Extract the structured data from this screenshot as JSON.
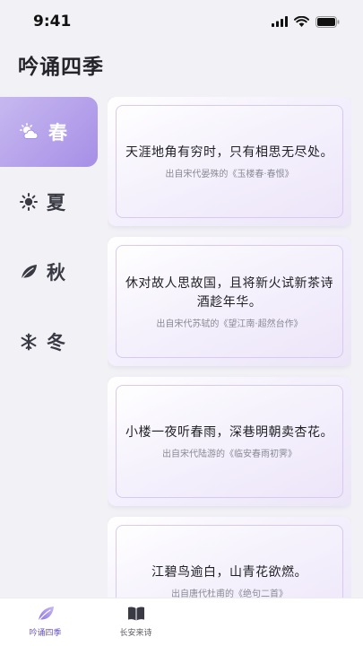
{
  "status_bar": {
    "time": "9:41"
  },
  "app": {
    "title": "吟诵四季"
  },
  "seasons": [
    {
      "label": "春",
      "icon": "cloud-sun-icon",
      "active": true
    },
    {
      "label": "夏",
      "icon": "sun-icon",
      "active": false
    },
    {
      "label": "秋",
      "icon": "leaf-icon",
      "active": false
    },
    {
      "label": "冬",
      "icon": "snowflake-icon",
      "active": false
    }
  ],
  "poems": [
    {
      "text": "天涯地角有穷时，只有相思无尽处。",
      "source": "出自宋代晏殊的《玉楼春·春恨》"
    },
    {
      "text": "休对故人思故国，且将新火试新茶诗酒趁年华。",
      "source": "出自宋代苏轼的《望江南·超然台作》"
    },
    {
      "text": "小楼一夜听春雨，深巷明朝卖杏花。",
      "source": "出自宋代陆游的《临安春雨初霁》"
    },
    {
      "text": "江碧鸟逾白，山青花欲燃。",
      "source": "出自唐代杜甫的《绝句二首》"
    }
  ],
  "tabs": [
    {
      "label": "吟诵四季",
      "icon": "leaf-icon",
      "active": true
    },
    {
      "label": "长安来诗",
      "icon": "book-icon",
      "active": false
    },
    {
      "label": "",
      "icon": "",
      "active": false
    },
    {
      "label": "",
      "icon": "",
      "active": false
    }
  ],
  "colors": {
    "accent": "#a68fe6",
    "accent_dark": "#6b55c9",
    "card_border": "#d7c9ef"
  }
}
